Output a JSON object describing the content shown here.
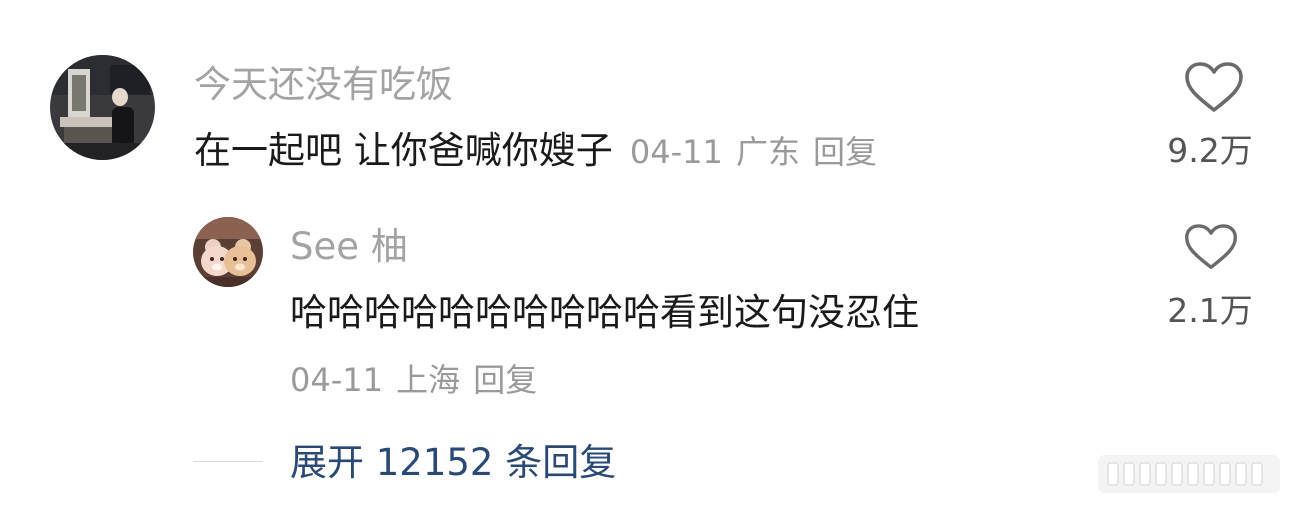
{
  "comments": [
    {
      "username": "今天还没有吃饭",
      "content": "在一起吧 让你爸喊你嫂子",
      "date": "04-11",
      "location": "广东",
      "reply_label": "回复",
      "like_count": "9.2万",
      "avatar_icon": "user-avatar-photo",
      "like_icon": "heart-outline-icon"
    },
    {
      "username": "See 柚",
      "content": "哈哈哈哈哈哈哈哈哈哈看到这句没忍住",
      "date": "04-11",
      "location": "上海",
      "reply_label": "回复",
      "like_count": "2.1万",
      "avatar_icon": "bear-avatar",
      "like_icon": "heart-outline-icon"
    }
  ],
  "expand": {
    "label": "展开 12152 条回复",
    "color": "#2a4a75"
  },
  "colors": {
    "username": "#a3a3a3",
    "content": "#1a1a1a",
    "meta": "#9a9a9a",
    "heart_stroke": "#6b6b6b"
  }
}
